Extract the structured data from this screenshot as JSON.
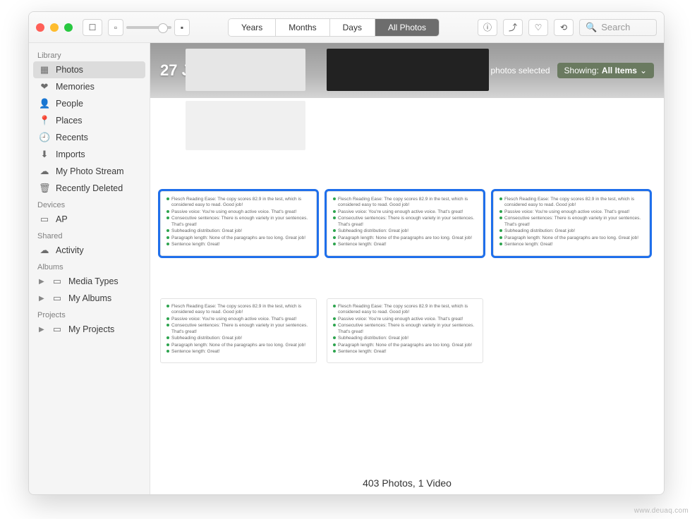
{
  "toolbar": {
    "tabs": {
      "years": "Years",
      "months": "Months",
      "days": "Days",
      "all": "All Photos"
    },
    "search_placeholder": "Search"
  },
  "sidebar": {
    "sections": {
      "library": "Library",
      "devices": "Devices",
      "shared": "Shared",
      "albums": "Albums",
      "projects": "Projects"
    },
    "library": [
      {
        "icon": "▦",
        "label": "Photos",
        "selected": true
      },
      {
        "icon": "❤",
        "label": "Memories"
      },
      {
        "icon": "👤",
        "label": "People"
      },
      {
        "icon": "📍",
        "label": "Places"
      },
      {
        "icon": "🕘",
        "label": "Recents"
      },
      {
        "icon": "⬇",
        "label": "Imports"
      },
      {
        "icon": "☁",
        "label": "My Photo Stream"
      },
      {
        "icon": "🗑",
        "label": "Recently Deleted"
      }
    ],
    "devices": [
      {
        "icon": "▭",
        "label": "AP"
      }
    ],
    "shared": [
      {
        "icon": "☁",
        "label": "Activity"
      }
    ],
    "albums": [
      {
        "icon": "▭",
        "label": "Media Types",
        "disclose": true
      },
      {
        "icon": "▭",
        "label": "My Albums",
        "disclose": true
      }
    ],
    "projects": [
      {
        "icon": "▭",
        "label": "My Projects",
        "disclose": true
      }
    ]
  },
  "header": {
    "date": "27 Jan 2020",
    "selection": "3 photos selected",
    "showing_label": "Showing:",
    "showing_value": "All Items"
  },
  "card_lines": [
    "Flesch Reading Ease: The copy scores 82.9 in the test, which is considered easy to read. Good job!",
    "Passive voice: You're using enough active voice. That's great!",
    "Consecutive sentences: There is enough variety in your sentences. That's great!",
    "Subheading distribution: Great job!",
    "Paragraph length: None of the paragraphs are too long. Great job!",
    "Sentence length: Great!"
  ],
  "footer": {
    "summary": "403 Photos, 1 Video"
  },
  "watermark": "www.deuaq.com"
}
